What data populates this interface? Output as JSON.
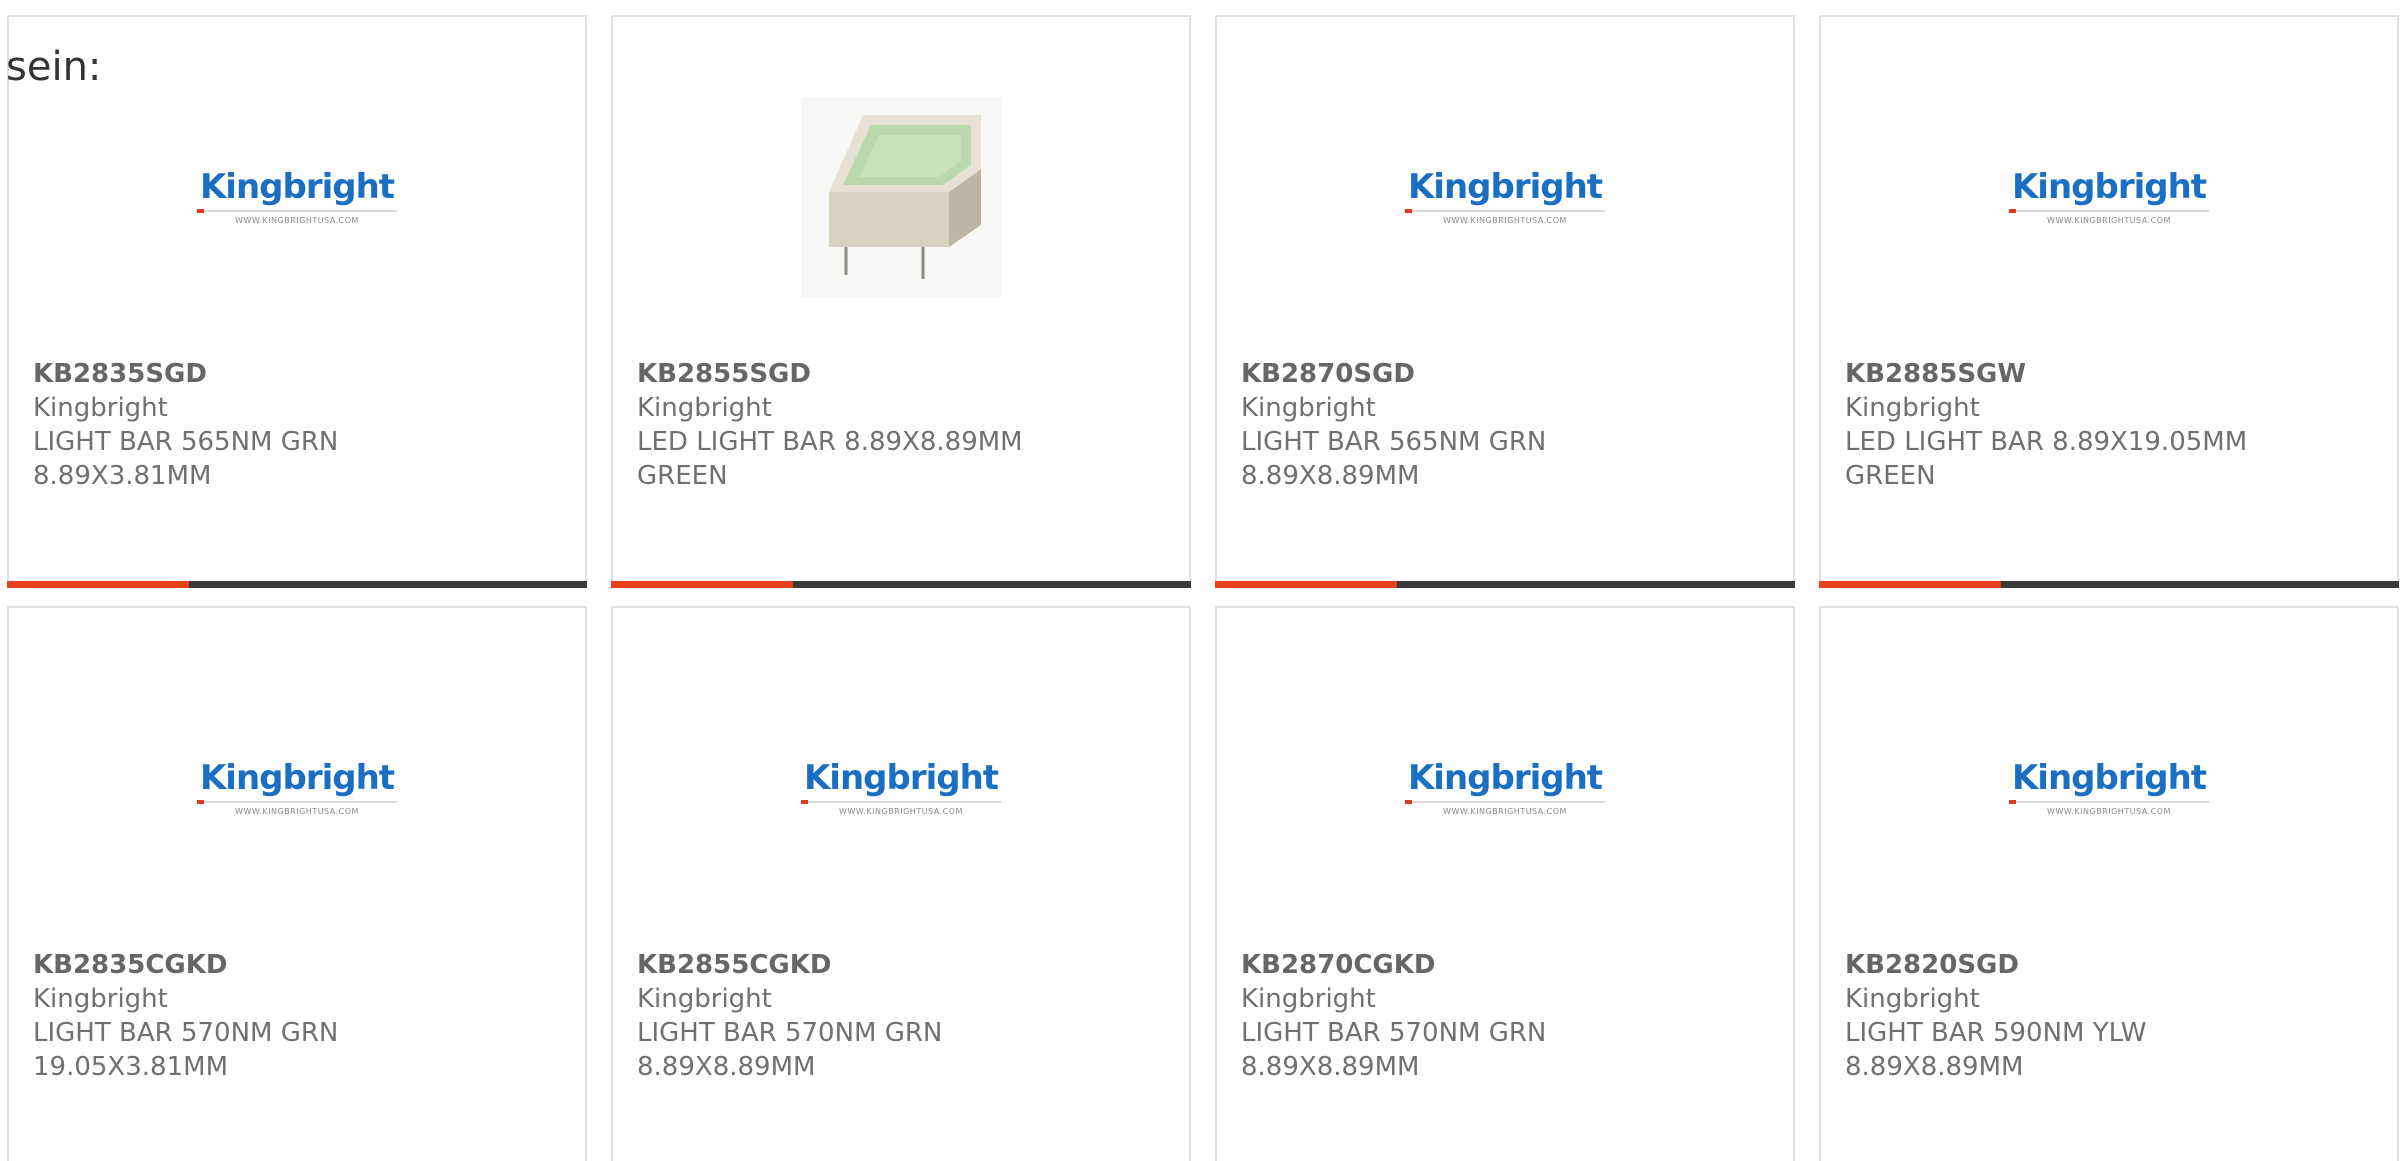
{
  "lead_text": "sein:",
  "brand": {
    "logo_word": "Kingbright",
    "logo_url": "WWW.KINGBRIGHTUSA.COM",
    "blue": "#1a6fc2",
    "red": "#e03a1e"
  },
  "accent_color": "#e8401c",
  "cards": [
    {
      "image": "kingbright-logo",
      "part": "KB2835SGD",
      "maker": "Kingbright",
      "desc1": "LIGHT BAR 565NM GRN",
      "desc2": "8.89X3.81MM"
    },
    {
      "image": "light-bar-photo",
      "part": "KB2855SGD",
      "maker": "Kingbright",
      "desc1": "LED LIGHT BAR 8.89X8.89MM",
      "desc2": "GREEN"
    },
    {
      "image": "kingbright-logo",
      "part": "KB2870SGD",
      "maker": "Kingbright",
      "desc1": "LIGHT BAR 565NM GRN",
      "desc2": "8.89X8.89MM"
    },
    {
      "image": "kingbright-logo",
      "part": "KB2885SGW",
      "maker": "Kingbright",
      "desc1": "LED LIGHT BAR 8.89X19.05MM",
      "desc2": "GREEN"
    },
    {
      "image": "kingbright-logo",
      "part": "KB2835CGKD",
      "maker": "Kingbright",
      "desc1": "LIGHT BAR 570NM GRN",
      "desc2": "19.05X3.81MM"
    },
    {
      "image": "kingbright-logo",
      "part": "KB2855CGKD",
      "maker": "Kingbright",
      "desc1": "LIGHT BAR 570NM GRN",
      "desc2": "8.89X8.89MM"
    },
    {
      "image": "kingbright-logo",
      "part": "KB2870CGKD",
      "maker": "Kingbright",
      "desc1": "LIGHT BAR 570NM GRN",
      "desc2": "8.89X8.89MM"
    },
    {
      "image": "kingbright-logo",
      "part": "KB2820SGD",
      "maker": "Kingbright",
      "desc1": "LIGHT BAR 590NM YLW",
      "desc2": "8.89X8.89MM"
    }
  ]
}
